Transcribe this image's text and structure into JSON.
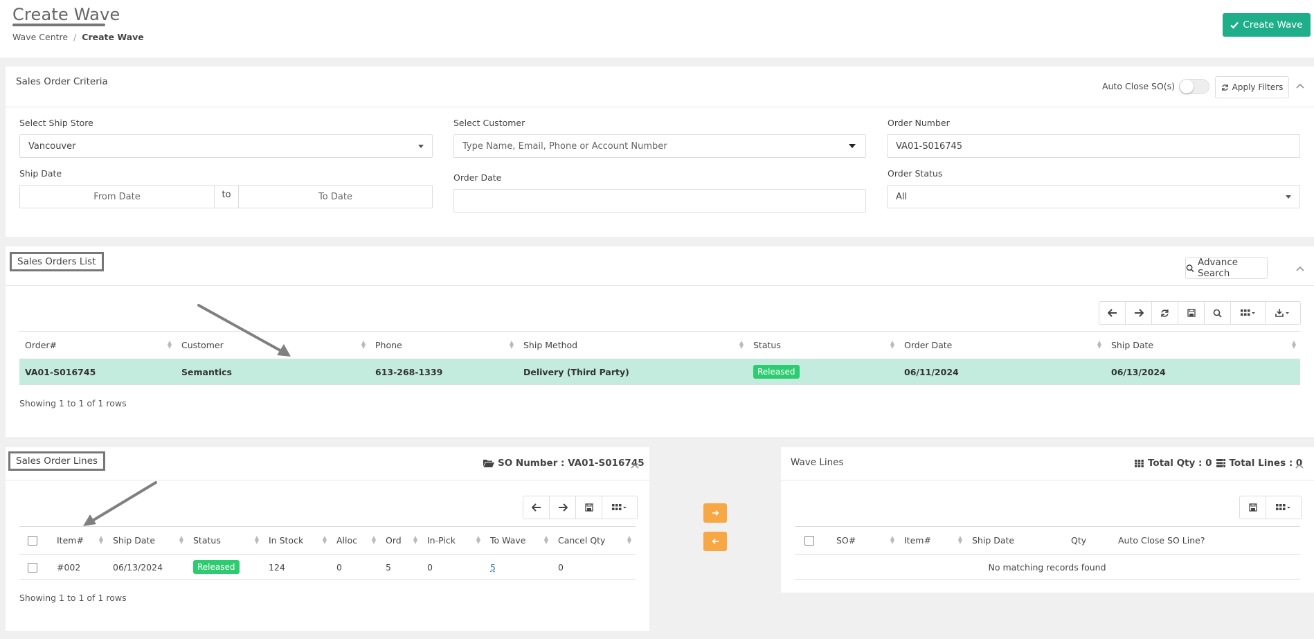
{
  "header": {
    "title": "Create Wave",
    "breadcrumb": [
      "Wave Centre",
      "/",
      "Create Wave"
    ],
    "create_button": "Create Wave"
  },
  "criteria": {
    "title": "Sales Order Criteria",
    "auto_close_label": "Auto Close SO(s)",
    "apply_filters": "Apply Filters",
    "ship_store_label": "Select Ship Store",
    "ship_store_value": "Vancouver",
    "customer_label": "Select Customer",
    "customer_placeholder": "Type Name, Email, Phone or Account Number",
    "order_number_label": "Order Number",
    "order_number_value": "VA01-S016745",
    "ship_date_label": "Ship Date",
    "from_date_placeholder": "From Date",
    "to_word": "to",
    "to_date_placeholder": "To Date",
    "order_date_label": "Order Date",
    "order_status_label": "Order Status",
    "order_status_value": "All"
  },
  "orders": {
    "title": "Sales Orders List",
    "advance_search": "Advance Search",
    "columns": [
      "Order#",
      "Customer",
      "Phone",
      "Ship Method",
      "Status",
      "Order Date",
      "Ship Date"
    ],
    "row": {
      "order": "VA01-S016745",
      "customer": "Semantics",
      "phone": "613-268-1339",
      "ship_method": "Delivery (Third Party)",
      "status": "Released",
      "order_date": "06/11/2024",
      "ship_date": "06/13/2024"
    },
    "footer": "Showing 1 to 1 of 1 rows"
  },
  "lines": {
    "title": "Sales Order Lines",
    "so_number": "SO Number : VA01-S016745",
    "columns": [
      "Item#",
      "Ship Date",
      "Status",
      "In Stock",
      "Alloc",
      "Ord",
      "In-Pick",
      "To Wave",
      "Cancel Qty"
    ],
    "row": {
      "item": "#002",
      "ship_date": "06/13/2024",
      "status": "Released",
      "in_stock": "124",
      "alloc": "0",
      "ord": "5",
      "in_pick": "0",
      "to_wave": "5",
      "cancel_qty": "0"
    },
    "footer": "Showing 1 to 1 of 1 rows"
  },
  "wave": {
    "title": "Wave Lines",
    "total_qty": "Total Qty : 0",
    "total_lines": "Total Lines : 0",
    "columns": [
      "SO#",
      "Item#",
      "Ship Date",
      "Qty",
      "Auto Close SO Line?"
    ],
    "empty": "No matching records found"
  },
  "colors": {
    "accent": "#1fae8a",
    "selected_row": "#c3ebde",
    "badge": "#2ecc71",
    "move_button": "#f7a744"
  },
  "icons": [
    "check-icon",
    "refresh-icon",
    "search-icon",
    "arrow-left-icon",
    "arrow-right-icon",
    "save-icon",
    "columns-icon",
    "download-icon",
    "folder-open-icon",
    "chevron-up-icon",
    "list-icon"
  ]
}
